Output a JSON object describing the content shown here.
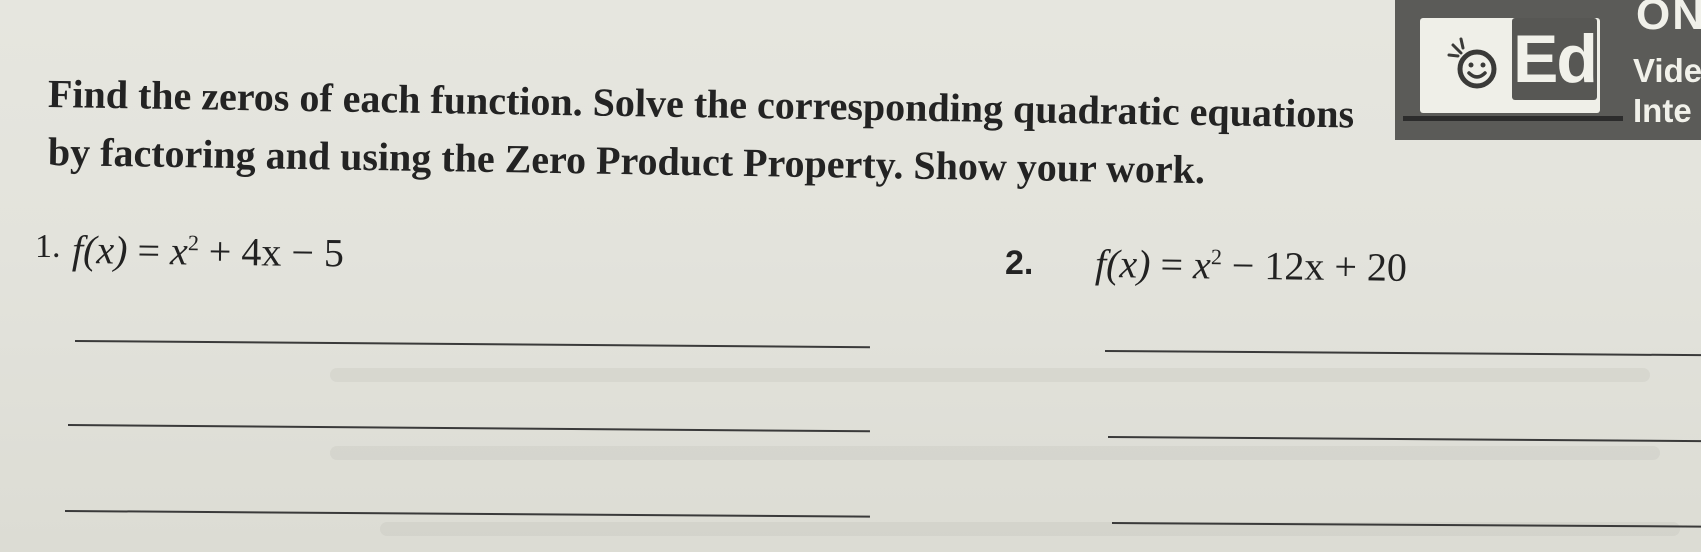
{
  "badge": {
    "word": "Ed",
    "top_label": "ON",
    "side_label_1": "Vide",
    "side_label_2": "Inte"
  },
  "instructions": {
    "line1": "Find the zeros of each function. Solve the corresponding quadratic equations",
    "line2": "by factoring and using the Zero Product Property. Show your work."
  },
  "problems": [
    {
      "number": "1.",
      "lhs": "f(x)",
      "rhs_a": "x",
      "exp": "2",
      "rhs_b": "+ 4x − 5"
    },
    {
      "number": "2.",
      "lhs": "f(x)",
      "rhs_a": "x",
      "exp": "2",
      "rhs_b": "− 12x + 20"
    }
  ]
}
